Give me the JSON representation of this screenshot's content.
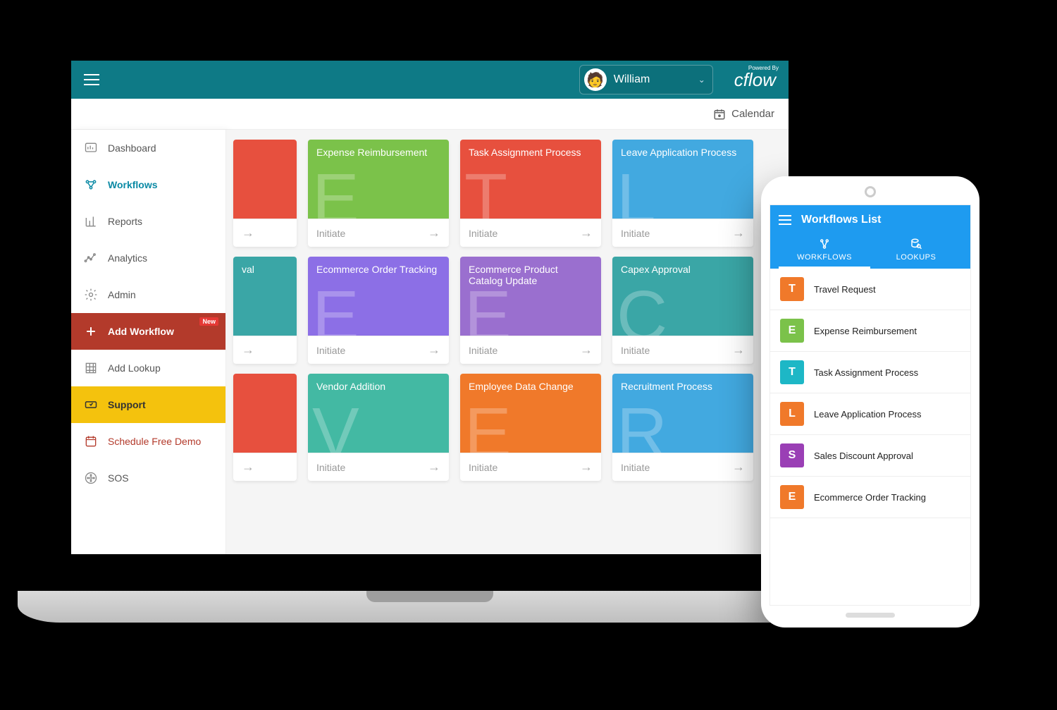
{
  "header": {
    "user_name": "William",
    "powered_by": "Powered By",
    "brand": "cflow",
    "calendar_label": "Calendar"
  },
  "sidebar": {
    "items": [
      {
        "label": "Dashboard"
      },
      {
        "label": "Workflows"
      },
      {
        "label": "Reports"
      },
      {
        "label": "Analytics"
      },
      {
        "label": "Admin"
      },
      {
        "label": "Add Workflow",
        "badge": "New"
      },
      {
        "label": "Add Lookup"
      },
      {
        "label": "Support"
      },
      {
        "label": "Schedule Free Demo"
      },
      {
        "label": "SOS"
      }
    ]
  },
  "cards": {
    "initiate_label": "Initiate",
    "row1": [
      {
        "title": "",
        "letter": "",
        "color": "#e7503e",
        "narrow": true
      },
      {
        "title": "Expense Reimbursement",
        "letter": "E",
        "color": "#7bc24a"
      },
      {
        "title": "Task Assignment Process",
        "letter": "T",
        "color": "#e7503e"
      },
      {
        "title": "Leave Application Process",
        "letter": "L",
        "color": "#42a9e0"
      }
    ],
    "row2": [
      {
        "title": "val",
        "letter": "",
        "color": "#3aa6a6",
        "narrow": true,
        "partial": true
      },
      {
        "title": "Ecommerce Order Tracking",
        "letter": "E",
        "color": "#8c6fe6"
      },
      {
        "title": "Ecommerce Product Catalog Update",
        "letter": "E",
        "color": "#9a6fcf"
      },
      {
        "title": "Capex Approval",
        "letter": "C",
        "color": "#3aa6a6"
      }
    ],
    "row3": [
      {
        "title": "",
        "letter": "",
        "color": "#e7503e",
        "narrow": true
      },
      {
        "title": "Vendor Addition",
        "letter": "V",
        "color": "#43b9a3"
      },
      {
        "title": "Employee Data Change",
        "letter": "E",
        "color": "#f0792a"
      },
      {
        "title": "Recruitment Process",
        "letter": "R",
        "color": "#42a9e0",
        "partial_right": true
      }
    ]
  },
  "phone": {
    "title": "Workflows List",
    "tabs": {
      "workflows": "WORKFLOWS",
      "lookups": "LOOKUPS"
    },
    "items": [
      {
        "letter": "T",
        "label": "Travel Request",
        "color": "#f0792a"
      },
      {
        "letter": "E",
        "label": "Expense Reimbursement",
        "color": "#7bc24a"
      },
      {
        "letter": "T",
        "label": "Task Assignment Process",
        "color": "#1db7c6"
      },
      {
        "letter": "L",
        "label": "Leave Application Process",
        "color": "#f0792a"
      },
      {
        "letter": "S",
        "label": "Sales Discount Approval",
        "color": "#9a3fb5"
      },
      {
        "letter": "E",
        "label": "Ecommerce Order Tracking",
        "color": "#f0792a"
      }
    ]
  }
}
